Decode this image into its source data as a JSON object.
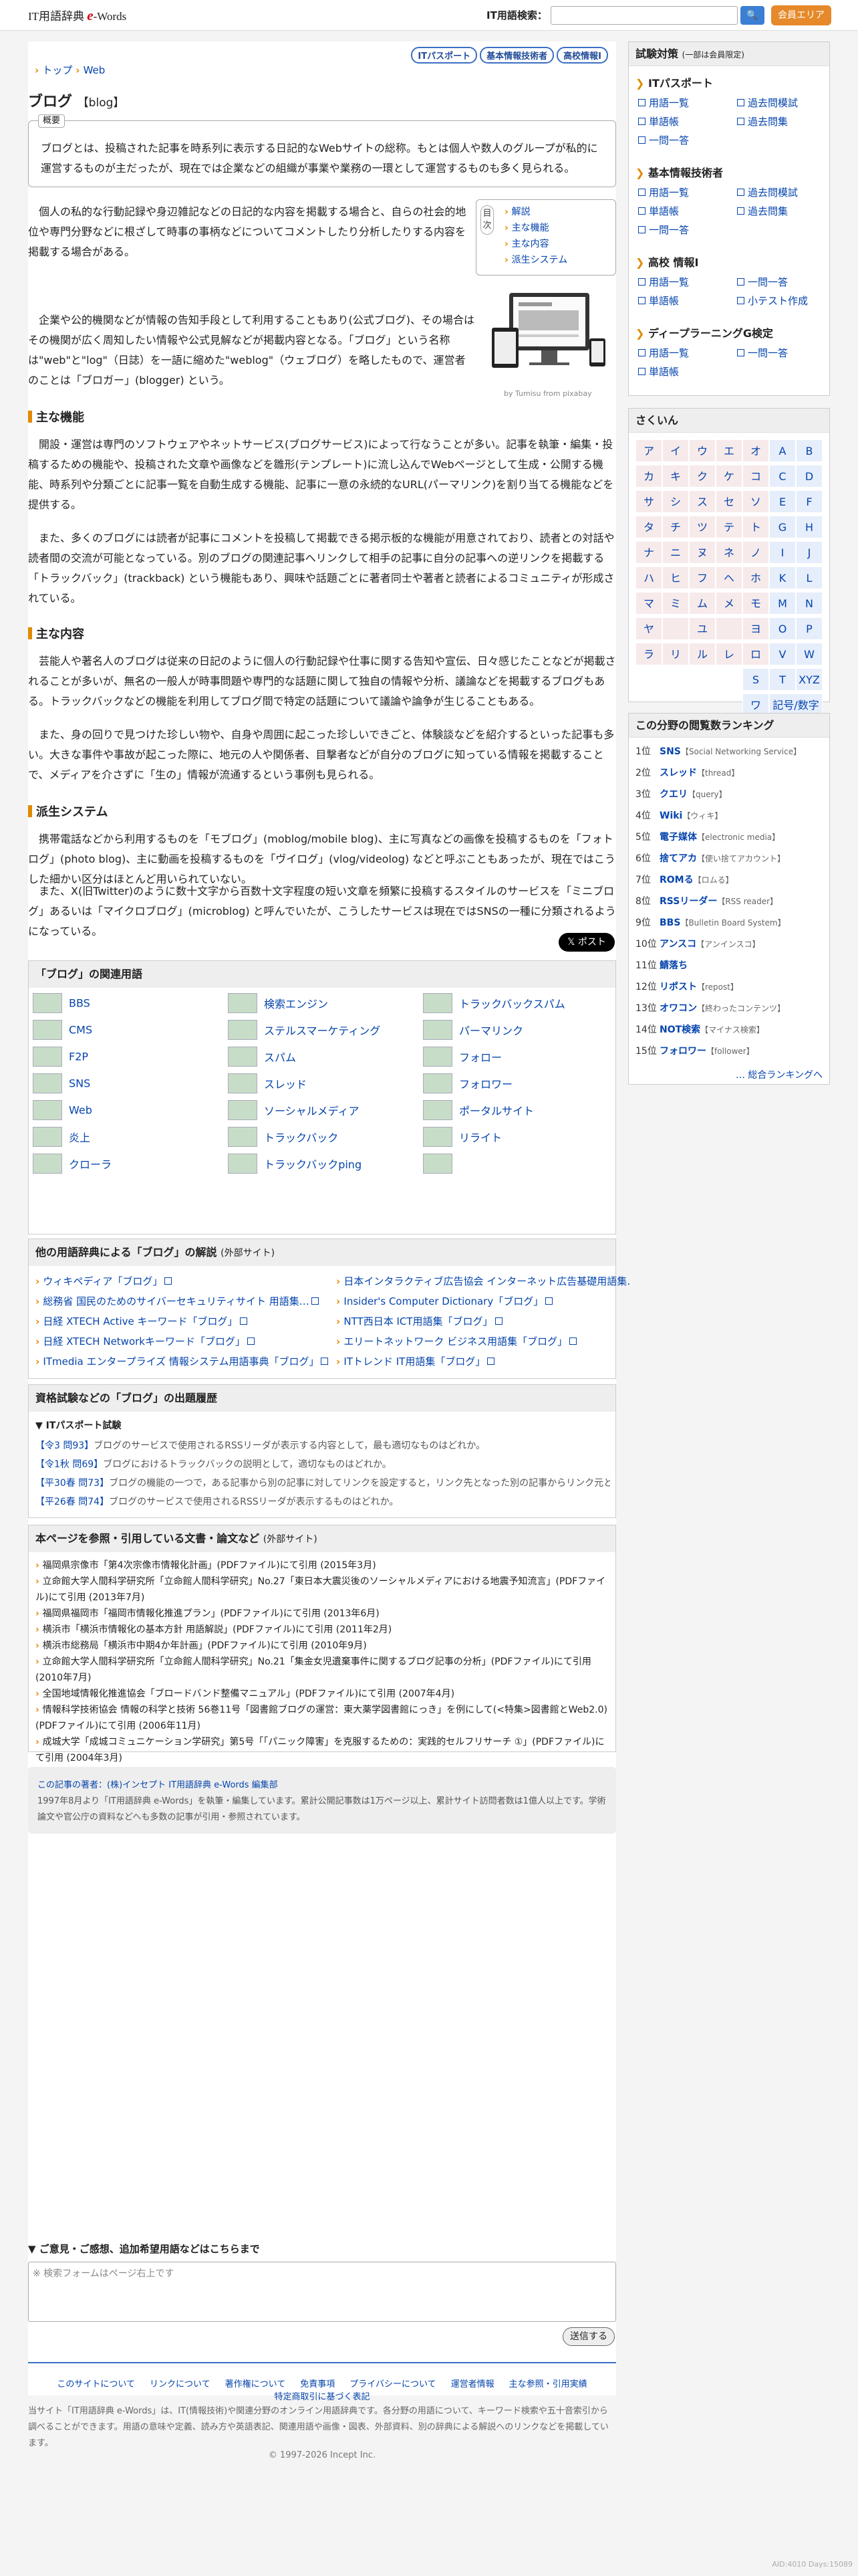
{
  "header": {
    "logo_prefix": "IT用語辞典",
    "logo_e": "e",
    "logo_suffix": "-Words",
    "search_label": "IT用語検索：",
    "search_icon": "🔍",
    "member_label": "会員エリア"
  },
  "pills": [
    "ITパスポート",
    "基本情報技術者",
    "高校情報Ⅰ"
  ],
  "breadcrumb": [
    "トップ",
    "Web"
  ],
  "title": {
    "main": "ブログ",
    "en": "【blog】"
  },
  "overview": {
    "label": "概要",
    "text": "ブログとは、投稿された記事を時系列に表示する日記的なWebサイトの総称。もとは個人や数人のグループが私的に運営するものが主だったが、現在では企業などの組織が事業や業務の一環として運営するものも多く見られる。"
  },
  "toc": {
    "label": "目次",
    "items": [
      "解説",
      "主な機能",
      "主な内容",
      "派生システム"
    ]
  },
  "photo_caption": "by Tumisu from pixabay",
  "p1": "個人の私的な行動記録や身辺雑記などの日記的な内容を掲載する場合と、自らの社会的地位や専門分野などに根ざして時事の事柄などについてコメントしたり分析したりする内容を掲載する場合がある。",
  "p2": "企業や公的機関などが情報の告知手段として利用することもあり(公式ブログ)、その場合はその機関が広く周知したい情報や公式見解などが掲載内容となる。「ブログ」という名称は\"web\"と\"log\"（日誌）を一語に縮めた\"weblog\"（ウェブログ）を略したもので、運営者のことは「ブロガー」(blogger) という。",
  "h_func": "主な機能",
  "p3": "開設・運営は専門のソフトウェアやネットサービス(ブログサービス)によって行なうことが多い。記事を執筆・編集・投稿するための機能や、投稿された文章や画像などを雛形(テンプレート)に流し込んでWebページとして生成・公開する機能、時系列や分類ごとに記事一覧を自動生成する機能、記事に一意の永続的なURL(パーマリンク)を割り当てる機能などを提供する。",
  "p4": "また、多くのブログには読者が記事にコメントを投稿して掲載できる掲示板的な機能が用意されており、読者との対話や読者間の交流が可能となっている。別のブログの関連記事へリンクして相手の記事に自分の記事への逆リンクを掲載する「トラックバック」(trackback) という機能もあり、興味や話題ごとに著者同士や著者と読者によるコミュニティが形成されている。",
  "h_content": "主な内容",
  "p5": "芸能人や著名人のブログは従来の日記のように個人の行動記録や仕事に関する告知や宣伝、日々感じたことなどが掲載されることが多いが、無名の一般人が時事問題や専門的な話題に関して独自の情報や分析、議論などを掲載するブログもある。トラックバックなどの機能を利用してブログ間で特定の話題について議論や論争が生じることもある。",
  "p6": "また、身の回りで見つけた珍しい物や、自身や周囲に起こった珍しいできごと、体験談などを紹介するといった記事も多い。大きな事件や事故が起こった際に、地元の人や関係者、目撃者などが自分のブログに知っている情報を掲載することで、メディアを介さずに「生の」情報が流通するという事例も見られる。",
  "h_deriv": "派生システム",
  "p7": "携帯電話などから利用するものを「モブログ」(moblog/mobile blog)、主に写真などの画像を投稿するものを「フォトログ」(photo blog)、主に動画を投稿するものを「ヴイログ」(vlog/videolog) などと呼ぶこともあったが、現在ではこうした細かい区分はほとんど用いられていない。",
  "p8": "また、X(旧Twitter)のように数十文字から百数十文字程度の短い文章を頻繁に投稿するスタイルのサービスを「ミニブログ」あるいは「マイクロブログ」(microblog) と呼んでいたが、こうしたサービスは現在ではSNSの一種に分類されるようになっている。",
  "post_label": "𝕏 ポスト",
  "related": {
    "title": "「ブログ」の関連用語",
    "items": [
      "BBS",
      "検索エンジン",
      "トラックバックスパム",
      "CMS",
      "ステルスマーケティング",
      "パーマリンク",
      "F2P",
      "スパム",
      "フォロー",
      "SNS",
      "スレッド",
      "フォロワー",
      "Web",
      "ソーシャルメディア",
      "ポータルサイト",
      "炎上",
      "トラックバック",
      "リライト",
      "クローラ",
      "トラックバックping",
      ""
    ]
  },
  "others": {
    "title": "他の用語辞典による「ブログ」の解説",
    "sub": "(外部サイト)",
    "items": [
      "ウィキペディア「ブログ」",
      "日本インタラクティブ広告協会 インターネット広告基礎用語集…",
      "総務省 国民のためのサイバーセキュリティサイト 用語集…",
      "Insider's Computer Dictionary「ブログ」",
      "日経 XTECH Active キーワード「ブログ」",
      "NTT西日本 ICT用語集「ブログ」",
      "日経 XTECH Networkキーワード「ブログ」",
      "エリートネットワーク ビジネス用語集「ブログ」",
      "ITmedia エンタープライズ 情報システム用語事典「ブログ」",
      "ITトレンド IT用語集「ブログ」"
    ]
  },
  "exams": {
    "title": "資格試験などの「ブログ」の出題履歴",
    "sub": "▼ ITパスポート試験",
    "items": [
      {
        "q": "【令3 問93】",
        "t": "ブログのサービスで使用されるRSSリーダが表示する内容として，最も適切なものはどれか。"
      },
      {
        "q": "【令1秋 問69】",
        "t": "ブログにおけるトラックバックの説明として，適切なものはどれか。"
      },
      {
        "q": "【平30春 問73】",
        "t": "ブログの機能の一つで，ある記事から別の記事に対してリンクを設定すると，リンク先となった別の記事からリンク元と…"
      },
      {
        "q": "【平26春 問74】",
        "t": "ブログのサービスで使用されるRSSリーダが表示するものはどれか。"
      }
    ]
  },
  "refs": {
    "title": "本ページを参照・引用している文書・論文など",
    "sub": "(外部サイト)",
    "items": [
      "福岡県宗像市「第4次宗像市情報化計画」(PDFファイル)にて引用 (2015年3月)",
      "立命館大学人間科学研究所「立命館人間科学研究」No.27「東日本大震災後のソーシャルメディアにおける地震予知流言」(PDFファイル)にて引用 (2013年7月)",
      "福岡県福岡市「福岡市情報化推進プラン」(PDFファイル)にて引用 (2013年6月)",
      "横浜市「横浜市情報化の基本方針 用語解説」(PDFファイル)にて引用 (2011年2月)",
      "横浜市総務局「横浜市中期4か年計画」(PDFファイル)にて引用 (2010年9月)",
      "立命館大学人間科学研究所「立命館人間科学研究」No.21「集金女児遺棄事件に関するブログ記事の分析」(PDFファイル)にて引用 (2010年7月)",
      "全国地域情報化推進協会「ブロードバンド整備マニュアル」(PDFファイル)にて引用 (2007年4月)",
      "情報科学技術協会 情報の科学と技術 56巻11号「図書館ブログの運営：東大薬学図書館にっき」を例にして(<特集>図書館とWeb2.0)(PDFファイル)にて引用 (2006年11月)",
      "成城大学「成城コミュニケーション学研究」第5号「「パニック障害」を克服するための：実践的セルフリサーチ ①」(PDFファイル)にて引用 (2004年3月)"
    ]
  },
  "author": {
    "line1": "この記事の著者：(株)インセプト IT用語辞典 e-Words 編集部",
    "line2": "1997年8月より「IT用語辞典 e-Words」を執筆・編集しています。累計公開記事数は1万ページ以上、累計サイト訪問者数は1億人以上です。学術論文や官公庁の資料などへも多数の記事が引用・参照されています。"
  },
  "feedback": {
    "title": "▼ ご意見・ご感想、追加希望用語などはこちらまで",
    "placeholder": "※ 検索フォームはページ右上です",
    "send": "送信する"
  },
  "footer": {
    "links": [
      "このサイトについて",
      "リンクについて",
      "著作権について",
      "免責事項",
      "プライバシーについて",
      "運営者情報",
      "主な参照・引用実績",
      "特定商取引に基づく表記"
    ],
    "desc": "当サイト「IT用語辞典 e-Words」は、IT(情報技術)や関連分野のオンライン用語辞典です。各分野の用語について、キーワード検索や五十音索引から調べることができます。用語の意味や定義、読み方や英語表記、関連用語や画像・図表、外部資料、別の辞典による解説へのリンクなどを掲載しています。",
    "copyright": "© 1997-2026 Incept Inc."
  },
  "sidebar": {
    "exam": {
      "title": "試験対策",
      "sub": "(一部は会員限定)",
      "sections": [
        {
          "name": "ITパスポート",
          "links": [
            "用語一覧",
            "過去問模試",
            "単語帳",
            "過去問集",
            "一問一答"
          ]
        },
        {
          "name": "基本情報技術者",
          "links": [
            "用語一覧",
            "過去問模試",
            "単語帳",
            "過去問集",
            "一問一答"
          ]
        },
        {
          "name": "高校 情報Ⅰ",
          "links": [
            "用語一覧",
            "一問一答",
            "単語帳",
            "小テスト作成"
          ]
        },
        {
          "name": "ディープラーニングG検定",
          "links": [
            "用語一覧",
            "一問一答",
            "単語帳"
          ]
        }
      ]
    },
    "index": {
      "title": "さくいん",
      "kana": [
        "ア",
        "イ",
        "ウ",
        "エ",
        "オ",
        "カ",
        "キ",
        "ク",
        "ケ",
        "コ",
        "サ",
        "シ",
        "ス",
        "セ",
        "ソ",
        "タ",
        "チ",
        "ツ",
        "テ",
        "ト",
        "ナ",
        "ニ",
        "ヌ",
        "ネ",
        "ノ",
        "ハ",
        "ヒ",
        "フ",
        "ヘ",
        "ホ",
        "マ",
        "ミ",
        "ム",
        "メ",
        "モ",
        "ヤ",
        "",
        "ユ",
        "",
        "ヨ",
        "ラ",
        "リ",
        "ル",
        "レ",
        "ロ"
      ],
      "latin": [
        "A",
        "B",
        "C",
        "D",
        "E",
        "F",
        "G",
        "H",
        "I",
        "J",
        "K",
        "L",
        "M",
        "N",
        "O",
        "P",
        "Q",
        "R",
        "S",
        "T",
        "U",
        "V",
        "W",
        "XYZ",
        "ワ",
        "記号/数字"
      ]
    },
    "ranking": {
      "title": "この分野の閲覧数ランキング",
      "items": [
        {
          "n": "1位",
          "w": "SNS",
          "r": "【Social Networking Service】"
        },
        {
          "n": "2位",
          "w": "スレッド",
          "r": "【thread】"
        },
        {
          "n": "3位",
          "w": "クエリ",
          "r": "【query】"
        },
        {
          "n": "4位",
          "w": "Wiki",
          "r": "【ウィキ】"
        },
        {
          "n": "5位",
          "w": "電子媒体",
          "r": "【electronic media】"
        },
        {
          "n": "6位",
          "w": "捨てアカ",
          "r": "【使い捨てアカウント】"
        },
        {
          "n": "7位",
          "w": "ROMる",
          "r": "【ロムる】"
        },
        {
          "n": "8位",
          "w": "RSSリーダー",
          "r": "【RSS reader】"
        },
        {
          "n": "9位",
          "w": "BBS",
          "r": "【Bulletin Board System】"
        },
        {
          "n": "10位",
          "w": "アンスコ",
          "r": "【アンインスコ】"
        },
        {
          "n": "11位",
          "w": "鯖落ち",
          "r": ""
        },
        {
          "n": "12位",
          "w": "リポスト",
          "r": "【repost】"
        },
        {
          "n": "13位",
          "w": "オワコン",
          "r": "【終わったコンテンツ】"
        },
        {
          "n": "14位",
          "w": "NOT検索",
          "r": "【マイナス検索】"
        },
        {
          "n": "15位",
          "w": "フォロワー",
          "r": "【follower】"
        }
      ],
      "more": "… 総合ランキングへ"
    }
  },
  "adid": "AID:4010 Days:15089"
}
